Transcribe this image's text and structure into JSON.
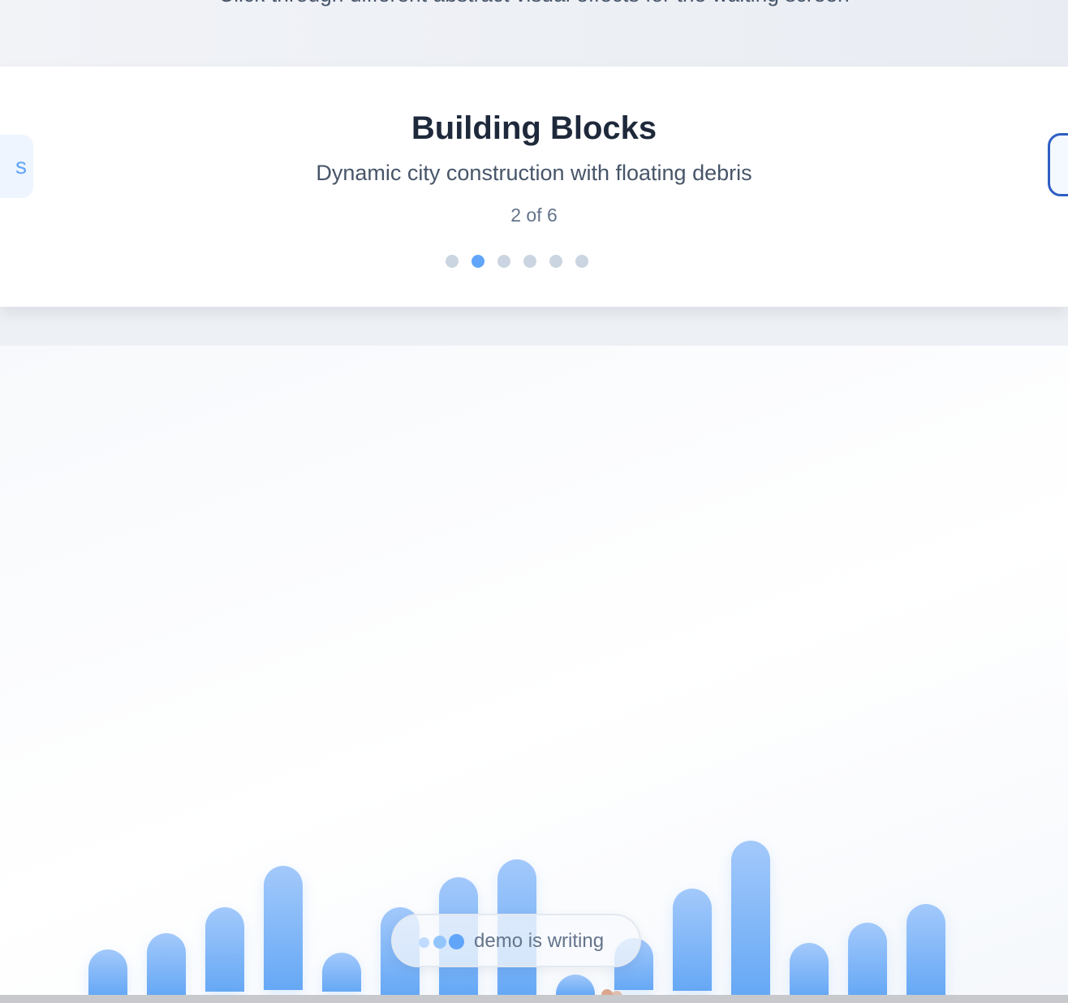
{
  "header": {
    "subtitle": "Click through different abstract visual effects for the waiting screen"
  },
  "carousel": {
    "prev_label": "s",
    "effect_title": "Building Blocks",
    "effect_description": "Dynamic city construction with floating debris",
    "counter": "2 of 6",
    "current_index": 2,
    "total": 6
  },
  "stage": {
    "status_text": "demo is writing"
  },
  "colors": {
    "accent": "#60a5fa",
    "bar_top": "#a3c9fb",
    "bar_bottom": "#66a8f5",
    "dot_inactive": "#cbd5e1",
    "next_border": "#2f5fc4"
  }
}
